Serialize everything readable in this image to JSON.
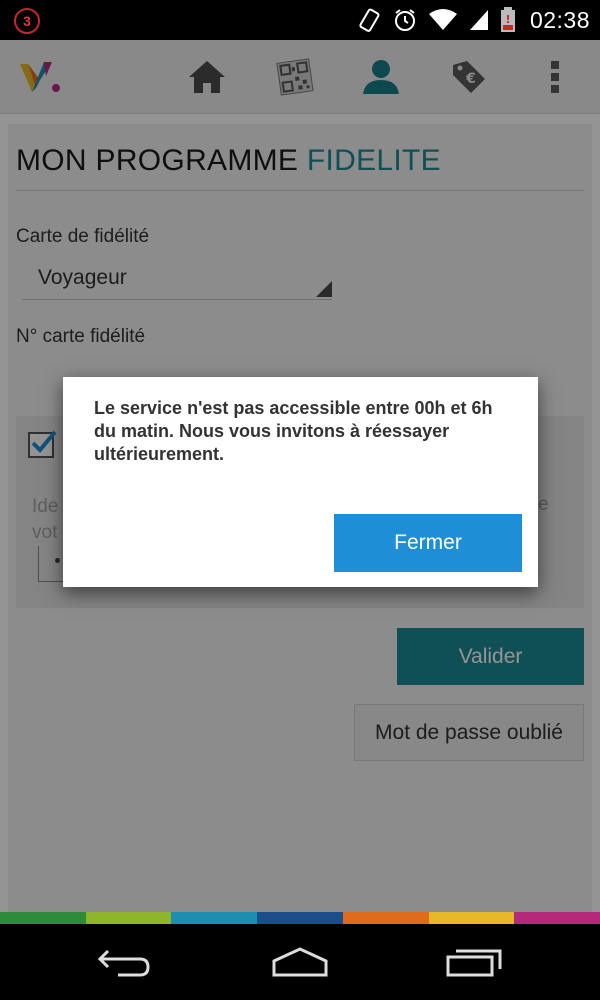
{
  "status_bar": {
    "notification_count": "3",
    "time": "02:38",
    "icons": [
      "rotate-icon",
      "alarm-icon",
      "wifi-icon",
      "signal-icon",
      "battery-low-icon"
    ]
  },
  "action_bar": {
    "logo": "V.",
    "icons": [
      "home-icon",
      "qr-code-icon",
      "profile-icon",
      "euro-tag-icon",
      "overflow-menu-icon"
    ]
  },
  "page": {
    "title_main": "MON PROGRAMME ",
    "title_accent": "FIDELITE",
    "card_label": "Carte de fidélité",
    "card_selected": "Voyageur",
    "card_number_label": "N° carte fidélité",
    "panel_text_partial": "Ide                                                                                 e vot",
    "validate_button": "Valider",
    "forgot_button": "Mot de passe oublié"
  },
  "dialog": {
    "message": "Le service n'est pas accessible entre 00h et 6h du matin. Nous vous invitons à  réessayer ultérieurement.",
    "close_button": "Fermer"
  },
  "colors": {
    "accent_teal": "#1b8a95",
    "dialog_button_blue": "#1e8fd6",
    "brand_strip": [
      "#2e8b3a",
      "#8fb52b",
      "#1c8fb0",
      "#1b4f8c",
      "#e06b1b",
      "#e6b82a",
      "#b5287a"
    ]
  }
}
